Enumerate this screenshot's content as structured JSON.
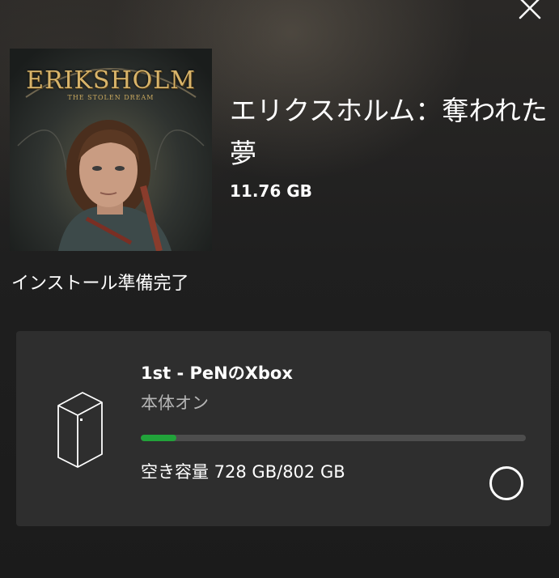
{
  "header": {
    "close_icon": "close-icon"
  },
  "game": {
    "cover_logo_text": "ERIKSHOLM",
    "cover_subtitle": "THE STOLEN DREAM",
    "title": "エリクスホルム：奪われた夢",
    "size": "11.76 GB",
    "status": "インストール準備完了"
  },
  "console": {
    "icon": "xbox-series-x-icon",
    "name": "1st - PeNのXbox",
    "state": "本体オン",
    "storage_label": "空き容量 728 GB/802 GB",
    "storage_used_fraction": 0.0923,
    "selected": false
  },
  "colors": {
    "progress_fill": "#21a33a",
    "progress_track": "#4d4d4d",
    "card_background": "#2e2e2e"
  }
}
